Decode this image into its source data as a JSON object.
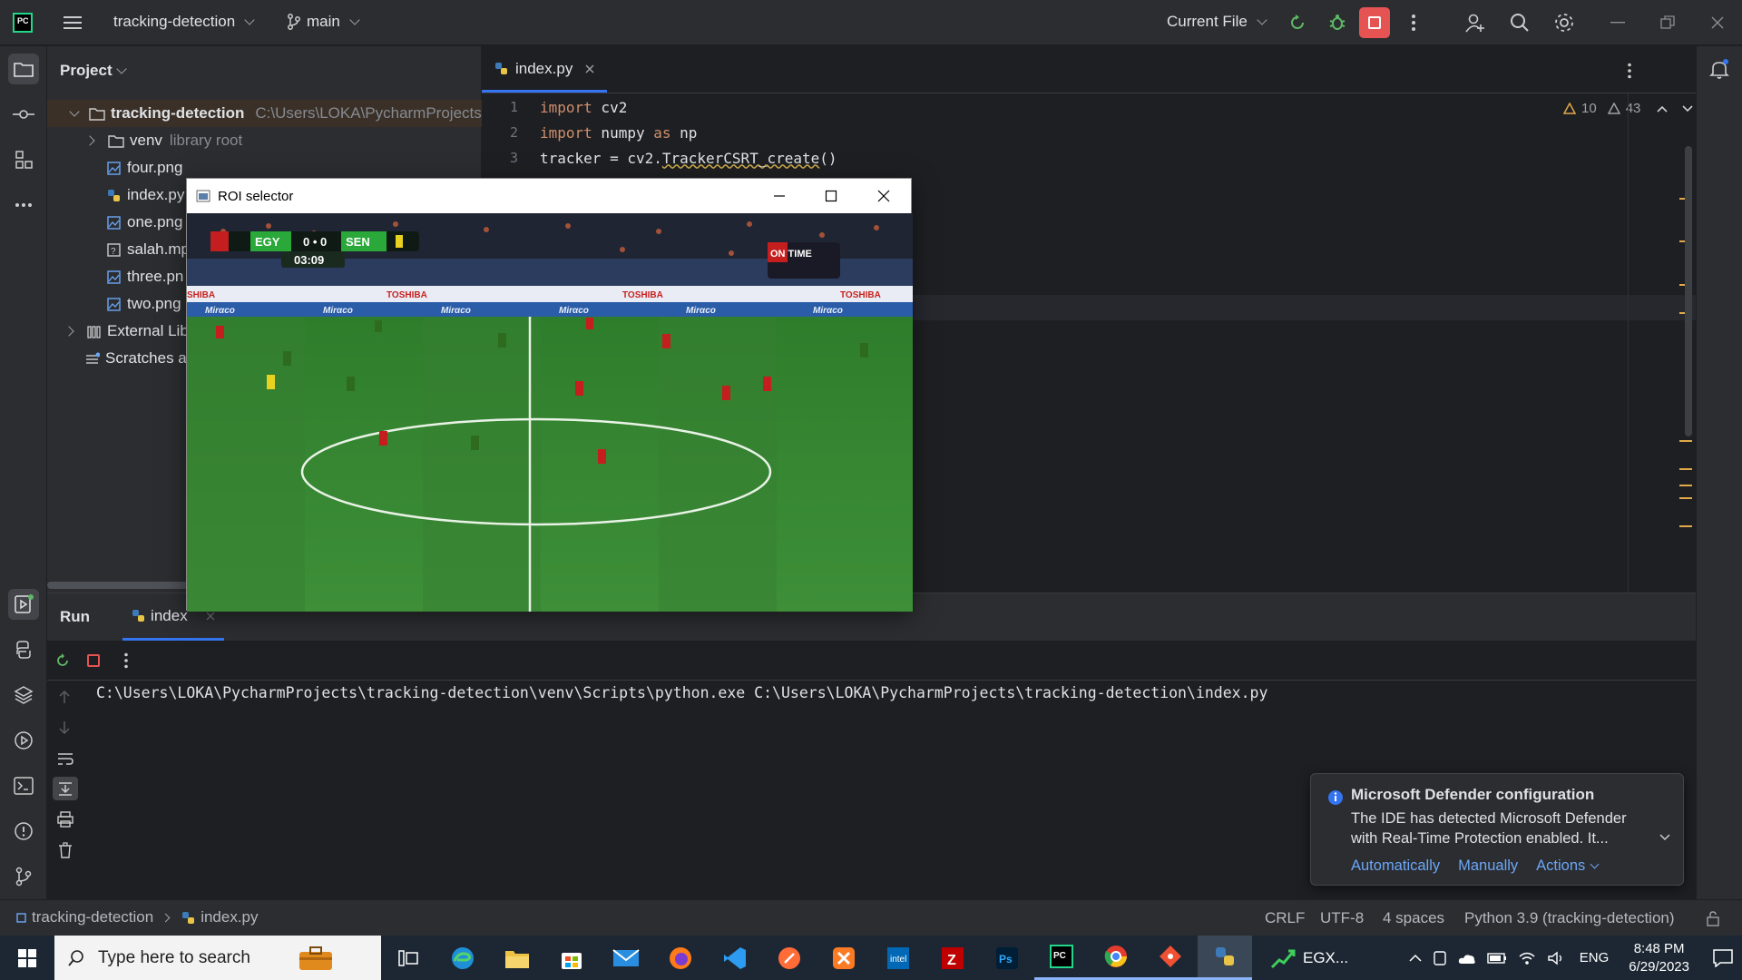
{
  "titlebar": {
    "project_name": "tracking-detection",
    "branch": "main",
    "run_config": "Current File"
  },
  "project_panel": {
    "title": "Project",
    "root": {
      "name": "tracking-detection",
      "path": "C:\\Users\\LOKA\\PycharmProjects"
    },
    "items": [
      {
        "name": "venv",
        "note": "library root"
      },
      {
        "name": "four.png"
      },
      {
        "name": "index.py"
      },
      {
        "name": "one.png"
      },
      {
        "name": "salah.mp"
      },
      {
        "name": "three.pn"
      },
      {
        "name": "two.png"
      }
    ],
    "external": "External Lib",
    "scratches": "Scratches a"
  },
  "editor": {
    "tab": "index.py",
    "lines": [
      {
        "num": "1",
        "kw": "import",
        "rest": " cv2"
      },
      {
        "num": "2",
        "kw": "import",
        "mid": " numpy ",
        "kw2": "as",
        "rest": " np"
      },
      {
        "num": "3",
        "pre": "tracker = cv2.",
        "fn": "TrackerCSRT_create",
        "post": "()"
      }
    ],
    "errors": "10",
    "warnings": "43"
  },
  "roi_window": {
    "title": "ROI selector",
    "score_left": "EGY",
    "score": "0 • 0",
    "score_right": "SEN",
    "clock": "03:09",
    "on_time": "ON TIME"
  },
  "run_panel": {
    "label": "Run",
    "tab": "index",
    "console": "C:\\Users\\LOKA\\PycharmProjects\\tracking-detection\\venv\\Scripts\\python.exe C:\\Users\\LOKA\\PycharmProjects\\tracking-detection\\index.py"
  },
  "notification": {
    "title": "Microsoft Defender configuration",
    "body": "The IDE has detected Microsoft Defender with Real-Time Protection enabled. It...",
    "actions": [
      "Automatically",
      "Manually",
      "Actions"
    ]
  },
  "statusbar": {
    "crumb_project": "tracking-detection",
    "crumb_file": "index.py",
    "line_sep": "CRLF",
    "encoding": "UTF-8",
    "indent": "4 spaces",
    "interpreter": "Python 3.9 (tracking-detection)"
  },
  "taskbar": {
    "search_placeholder": "Type here to search",
    "egx_label": "EGX...",
    "lang": "ENG",
    "time": "8:48 PM",
    "date": "6/29/2023"
  },
  "colors": {
    "accent": "#3574f0",
    "stop_red": "#e55353",
    "run_green": "#5fb865",
    "warning": "#e0a94a"
  }
}
